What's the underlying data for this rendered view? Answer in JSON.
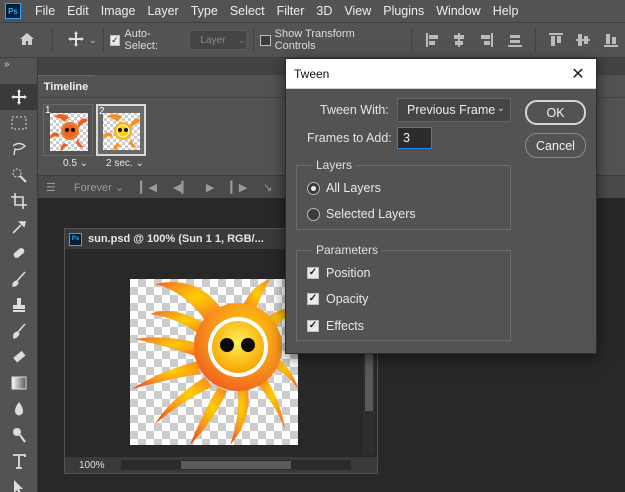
{
  "app": {
    "logo_text": "Ps"
  },
  "menu": [
    "File",
    "Edit",
    "Image",
    "Layer",
    "Type",
    "Select",
    "Filter",
    "3D",
    "View",
    "Plugins",
    "Window",
    "Help"
  ],
  "options_bar": {
    "auto_select_label": "Auto-Select:",
    "auto_select_checked": true,
    "auto_select_target": "Layer",
    "show_transform_label": "Show Transform Controls",
    "show_transform_checked": false
  },
  "timeline": {
    "tab_label": "Timeline",
    "frames": [
      {
        "number": "1",
        "delay": "0.5",
        "selected": false
      },
      {
        "number": "2",
        "delay": "2 sec.",
        "selected": true
      }
    ],
    "loop_label": "Forever"
  },
  "document": {
    "title": "sun.psd @ 100% (Sun 1 1, RGB/...",
    "zoom": "100%"
  },
  "dialog": {
    "title": "Tween",
    "tween_with_label": "Tween With:",
    "tween_with_value": "Previous Frame",
    "frames_to_add_label": "Frames to Add:",
    "frames_to_add_value": "3",
    "ok_label": "OK",
    "cancel_label": "Cancel",
    "layers_group": "Layers",
    "all_layers_label": "All Layers",
    "selected_layers_label": "Selected Layers",
    "parameters_group": "Parameters",
    "position_label": "Position",
    "opacity_label": "Opacity",
    "effects_label": "Effects"
  },
  "colors": {
    "sun_outer": "#f7901e",
    "sun_inner": "#fdd100",
    "panel": "#535353",
    "accent": "#31a8ff"
  }
}
